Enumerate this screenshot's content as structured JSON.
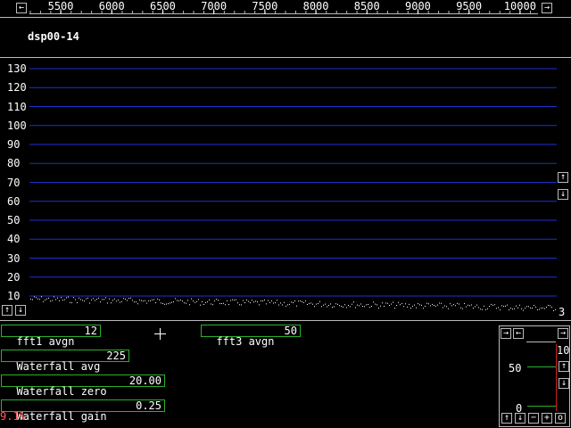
{
  "freq_ruler": {
    "labels": [
      "5500",
      "6000",
      "6500",
      "7000",
      "7500",
      "8000",
      "8500",
      "9000",
      "9500",
      "10000"
    ],
    "left_arrow": "←",
    "right_arrow": "→"
  },
  "station": "dsp00-14",
  "spectrum": {
    "y_labels": [
      "130",
      "120",
      "110",
      "100",
      "90",
      "80",
      "70",
      "60",
      "50",
      "40",
      "30",
      "20",
      "10"
    ],
    "scale_up": "↑",
    "scale_down": "↓",
    "pan_up": "↑",
    "pan_down": "↓",
    "channel_index": "3",
    "grid_color": "#1f2fd0"
  },
  "params": {
    "fft1_avgn": {
      "label": "fft1 avgn",
      "value": "12"
    },
    "fft3_avgn": {
      "label": "fft3 avgn",
      "value": "50"
    },
    "waterfall_avg": {
      "label": "Waterfall avg",
      "value": "225"
    },
    "waterfall_zero": {
      "label": "Waterfall zero",
      "value": "20.00"
    },
    "waterfall_gain": {
      "label": "Waterfall gain",
      "value": "0.25"
    },
    "cpu_load": "9.1%"
  },
  "smeter": {
    "arrow_right1": "→",
    "arrow_left": "←",
    "arrow_right2": "→",
    "label_top": "10",
    "label_mid": "50",
    "label_bottom": "0",
    "btn_up": "↑",
    "btn_down": "↓",
    "btn_minus": "−",
    "btn_plus": "+",
    "btn_o": "o",
    "side_up": "↑",
    "side_down": "↓"
  }
}
